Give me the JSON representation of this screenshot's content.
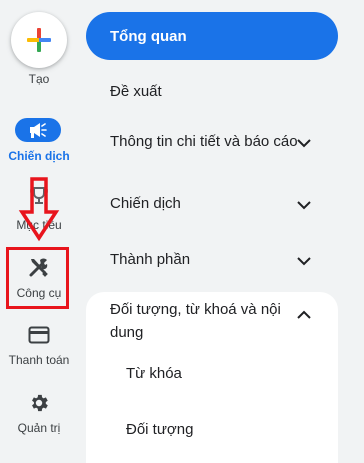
{
  "rail": {
    "create_label": "Tạo",
    "campaigns_label": "Chiến dịch",
    "goals_label": "Mục tiêu",
    "tools_label": "Công cụ",
    "billing_label": "Thanh toán",
    "admin_label": "Quản trị"
  },
  "menu": {
    "overview": "Tổng quan",
    "recommendations": "Đề xuất",
    "insights_reports": "Thông tin chi tiết và báo cáo",
    "campaigns": "Chiến dịch",
    "assets": "Thành phần",
    "audiences_section": {
      "title": "Đối tượng, từ khoá và nội dung",
      "items": [
        "Từ khóa",
        "Đối tượng"
      ]
    }
  },
  "colors": {
    "accent": "#1a73e8",
    "annotation": "#e8141c",
    "background": "#f1f3f4"
  },
  "icons": {
    "create": "plus-icon",
    "campaigns": "megaphone-icon",
    "goals": "trophy-icon",
    "tools": "tools-icon",
    "billing": "credit-card-icon",
    "admin": "gear-icon",
    "expand": "chevron-down-icon",
    "collapse": "chevron-up-icon"
  }
}
